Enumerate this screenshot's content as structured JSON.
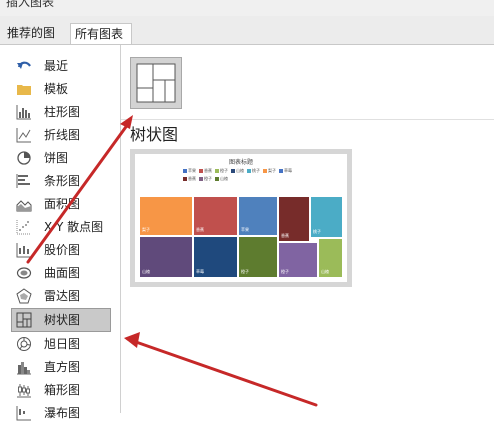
{
  "dialog_title": "插入图表",
  "tabs": [
    {
      "label": "推荐的图表"
    },
    {
      "label": "所有图表"
    }
  ],
  "sidebar": {
    "items": [
      {
        "label": "最近",
        "icon": "undo-arrow-icon"
      },
      {
        "label": "模板",
        "icon": "folder-icon"
      },
      {
        "label": "柱形图",
        "icon": "column-chart-icon"
      },
      {
        "label": "折线图",
        "icon": "line-chart-icon"
      },
      {
        "label": "饼图",
        "icon": "pie-chart-icon"
      },
      {
        "label": "条形图",
        "icon": "bar-chart-icon"
      },
      {
        "label": "面积图",
        "icon": "area-chart-icon"
      },
      {
        "label": "X Y 散点图",
        "icon": "scatter-chart-icon"
      },
      {
        "label": "股价图",
        "icon": "stock-chart-icon"
      },
      {
        "label": "曲面图",
        "icon": "surface-chart-icon"
      },
      {
        "label": "雷达图",
        "icon": "radar-chart-icon"
      },
      {
        "label": "树状图",
        "icon": "treemap-chart-icon",
        "selected": true
      },
      {
        "label": "旭日图",
        "icon": "sunburst-chart-icon"
      },
      {
        "label": "直方图",
        "icon": "histogram-chart-icon"
      },
      {
        "label": "箱形图",
        "icon": "box-whisker-chart-icon"
      },
      {
        "label": "瀑布图",
        "icon": "waterfall-chart-icon"
      }
    ]
  },
  "main": {
    "chart_type_title": "树状图",
    "preview": {
      "title": "图表标题",
      "legend": [
        {
          "label": "苹果",
          "color": "#4472c4"
        },
        {
          "label": "香蕉",
          "color": "#c0504d"
        },
        {
          "label": "橙子",
          "color": "#9bbb59"
        },
        {
          "label": "山楂",
          "color": "#2b4a7a"
        },
        {
          "label": "桃子",
          "color": "#4bacc6"
        },
        {
          "label": "梨子",
          "color": "#f79646"
        },
        {
          "label": "草莓",
          "color": "#4472c4"
        },
        {
          "label": "香蕉",
          "color": "#772c2a"
        },
        {
          "label": "橙子",
          "color": "#7f6084"
        },
        {
          "label": "山楂",
          "color": "#5e7c2f"
        }
      ],
      "tiles": [
        {
          "label": "梨子",
          "color": "#f79646"
        },
        {
          "label": "香蕉",
          "color": "#c0504d"
        },
        {
          "label": "苹果",
          "color": "#4f81bd"
        },
        {
          "label": "香蕉",
          "color": "#772c2a"
        },
        {
          "label": "桃子",
          "color": "#4bacc6"
        },
        {
          "label": "山楂",
          "color": "#604a7b"
        },
        {
          "label": "草莓",
          "color": "#1f497d"
        },
        {
          "label": "橙子",
          "color": "#5e7c2f"
        },
        {
          "label": "橙子",
          "color": "#8064a2"
        },
        {
          "label": "山楂",
          "color": "#9bbb59"
        }
      ]
    }
  },
  "annotation_color": "#c62828"
}
